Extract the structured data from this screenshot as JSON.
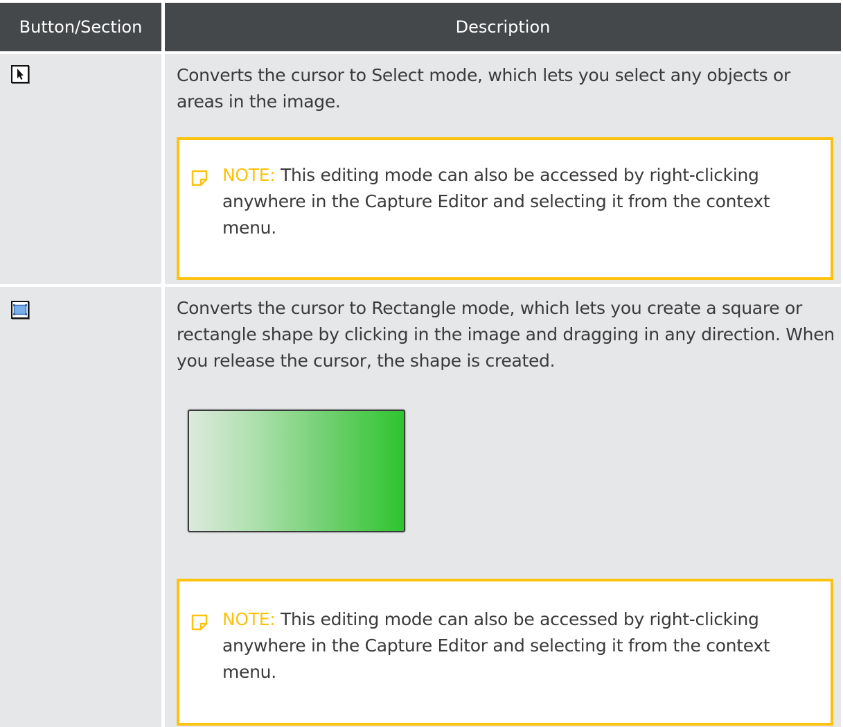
{
  "header": {
    "col1_label": "Button/Section",
    "col2_label": "Description"
  },
  "rows": [
    {
      "icon": "select-arrow-icon",
      "description": "Converts the cursor to Select mode, which lets you select any objects or areas in the image.",
      "note": {
        "label": "NOTE:",
        "text": " This editing mode can also be accessed by right-clicking anywhere in the Capture Editor and selecting it from the context menu."
      }
    },
    {
      "icon": "rectangle-tool-icon",
      "description": "Converts the cursor to Rectangle mode, which lets you create a square or rectangle shape by clicking in the image and dragging in any direction. When you release the cursor, the shape is created.",
      "example": "green-gradient-rectangle",
      "note": {
        "label": "NOTE:",
        "text": " This editing mode can also be accessed by right-clicking anywhere in the Capture Editor and selecting it from the context menu."
      }
    }
  ],
  "colors": {
    "header_bg": "#45484b",
    "cell_bg": "#e6e7e9",
    "note_accent": "#fdc20f",
    "body_text": "#3a3a3a"
  }
}
